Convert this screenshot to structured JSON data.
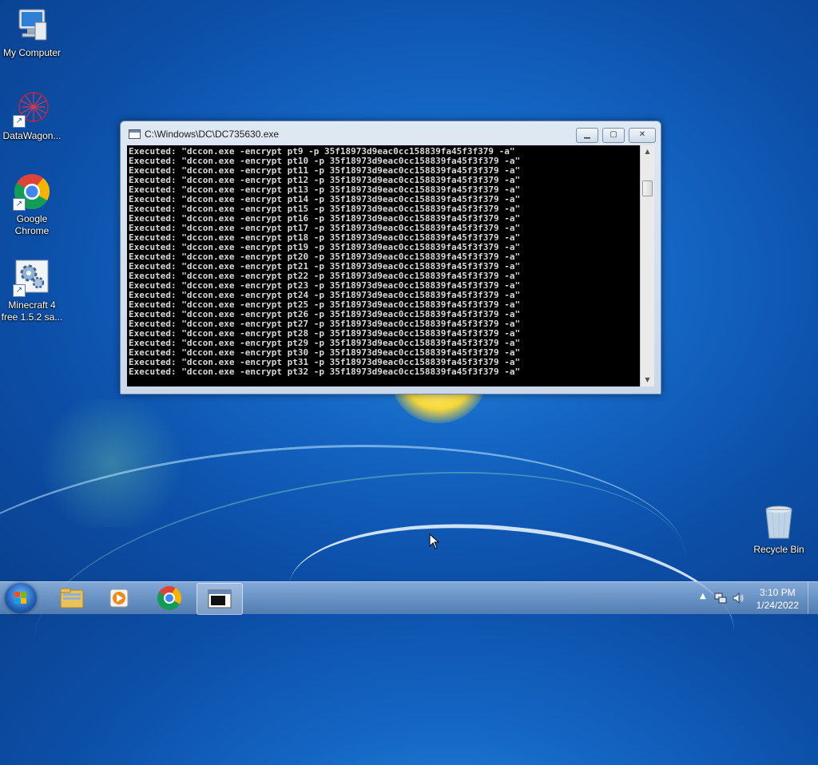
{
  "desktop": {
    "icons": [
      {
        "label": "My Computer"
      },
      {
        "label": "DataWagon..."
      },
      {
        "label": "Google Chrome"
      },
      {
        "label": "Minecraft 4 free 1.5.2 sa..."
      },
      {
        "label": "Recycle Bin"
      }
    ]
  },
  "console_window": {
    "title": "C:\\Windows\\DC\\DC735630.exe",
    "lines": [
      "Executed: \"dccon.exe -encrypt pt9 -p 35f18973d9eac0cc158839fa45f3f379 -a\"",
      "Executed: \"dccon.exe -encrypt pt10 -p 35f18973d9eac0cc158839fa45f3f379 -a\"",
      "Executed: \"dccon.exe -encrypt pt11 -p 35f18973d9eac0cc158839fa45f3f379 -a\"",
      "Executed: \"dccon.exe -encrypt pt12 -p 35f18973d9eac0cc158839fa45f3f379 -a\"",
      "Executed: \"dccon.exe -encrypt pt13 -p 35f18973d9eac0cc158839fa45f3f379 -a\"",
      "Executed: \"dccon.exe -encrypt pt14 -p 35f18973d9eac0cc158839fa45f3f379 -a\"",
      "Executed: \"dccon.exe -encrypt pt15 -p 35f18973d9eac0cc158839fa45f3f379 -a\"",
      "Executed: \"dccon.exe -encrypt pt16 -p 35f18973d9eac0cc158839fa45f3f379 -a\"",
      "Executed: \"dccon.exe -encrypt pt17 -p 35f18973d9eac0cc158839fa45f3f379 -a\"",
      "Executed: \"dccon.exe -encrypt pt18 -p 35f18973d9eac0cc158839fa45f3f379 -a\"",
      "Executed: \"dccon.exe -encrypt pt19 -p 35f18973d9eac0cc158839fa45f3f379 -a\"",
      "Executed: \"dccon.exe -encrypt pt20 -p 35f18973d9eac0cc158839fa45f3f379 -a\"",
      "Executed: \"dccon.exe -encrypt pt21 -p 35f18973d9eac0cc158839fa45f3f379 -a\"",
      "Executed: \"dccon.exe -encrypt pt22 -p 35f18973d9eac0cc158839fa45f3f379 -a\"",
      "Executed: \"dccon.exe -encrypt pt23 -p 35f18973d9eac0cc158839fa45f3f379 -a\"",
      "Executed: \"dccon.exe -encrypt pt24 -p 35f18973d9eac0cc158839fa45f3f379 -a\"",
      "Executed: \"dccon.exe -encrypt pt25 -p 35f18973d9eac0cc158839fa45f3f379 -a\"",
      "Executed: \"dccon.exe -encrypt pt26 -p 35f18973d9eac0cc158839fa45f3f379 -a\"",
      "Executed: \"dccon.exe -encrypt pt27 -p 35f18973d9eac0cc158839fa45f3f379 -a\"",
      "Executed: \"dccon.exe -encrypt pt28 -p 35f18973d9eac0cc158839fa45f3f379 -a\"",
      "Executed: \"dccon.exe -encrypt pt29 -p 35f18973d9eac0cc158839fa45f3f379 -a\"",
      "Executed: \"dccon.exe -encrypt pt30 -p 35f18973d9eac0cc158839fa45f3f379 -a\"",
      "Executed: \"dccon.exe -encrypt pt31 -p 35f18973d9eac0cc158839fa45f3f379 -a\"",
      "Executed: \"dccon.exe -encrypt pt32 -p 35f18973d9eac0cc158839fa45f3f379 -a\""
    ],
    "controls": {
      "minimize": "minimize-icon",
      "maximize": "maximize-icon",
      "close": "close-icon"
    }
  },
  "taskbar": {
    "apps": [
      {
        "icon": "folder-icon"
      },
      {
        "icon": "media-player-icon"
      },
      {
        "icon": "chrome-icon"
      },
      {
        "icon": "console-window-icon",
        "active": true
      }
    ],
    "clock": {
      "time": "3:10 PM",
      "date": "1/24/2022"
    }
  },
  "colors": {
    "accent": "#1466c4",
    "console_bg": "#000000",
    "console_fg": "#d9d9d9"
  }
}
